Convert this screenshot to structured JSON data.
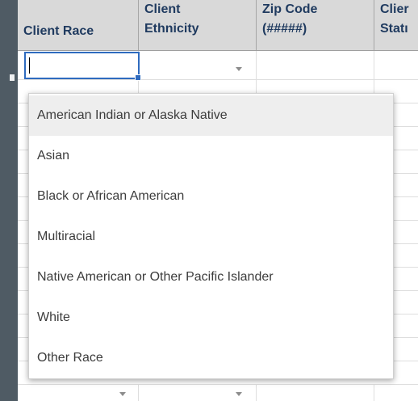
{
  "header": {
    "columns": [
      {
        "line1": "",
        "line2": "Client Race"
      },
      {
        "line1": "Client",
        "line2": "Ethnicity"
      },
      {
        "line1": "Zip Code",
        "line2": "(#####)"
      },
      {
        "line1": "Clier",
        "line2": "Statı"
      }
    ]
  },
  "active_cell": {
    "value": ""
  },
  "dropdown": {
    "options": [
      "American Indian or Alaska Native",
      "Asian",
      "Black or African American",
      "Multiracial",
      "Native American or Other Pacific Islander",
      "White",
      "Other Race"
    ],
    "highlighted_index": 0
  },
  "colors": {
    "accent": "#2f6bbf",
    "header_bg": "#d9d9d9",
    "header_text": "#1f3a5f",
    "frame_bg": "#4f5b64"
  },
  "icons": [
    "dropdown-arrow-icon"
  ]
}
